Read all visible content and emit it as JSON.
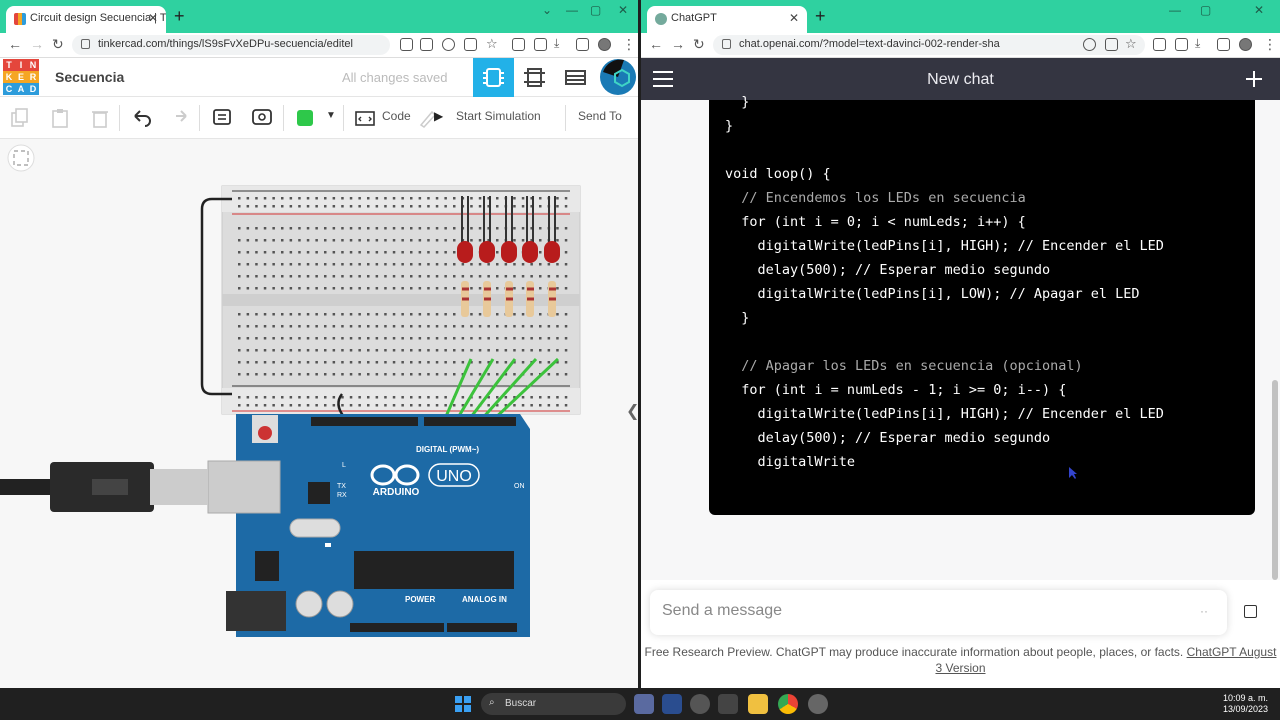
{
  "left_browser": {
    "tab_title": "Circuit design Secuencia | Tinke",
    "url": "tinkercad.com/things/lS9sFvXeDPu-secuencia/editel"
  },
  "right_browser": {
    "tab_title": "ChatGPT",
    "url": "chat.openai.com/?model=text-davinci-002-render-sha"
  },
  "tinkercad": {
    "logo_letters": [
      "T",
      "I",
      "N",
      "K",
      "E",
      "R",
      "C",
      "A",
      "D"
    ],
    "logo_colors": [
      "#e4463c",
      "#e4463c",
      "#e4463c",
      "#f5a623",
      "#f5a623",
      "#f5a623",
      "#2d9cdb",
      "#2d9cdb",
      "#2d9cdb"
    ],
    "design_name": "Secuencia",
    "save_status": "All changes saved",
    "code_label": "Code",
    "start_simulation_label": "Start Simulation",
    "send_to_label": "Send To",
    "accent": "#22b1e8",
    "color_swatch": "#2ec84a"
  },
  "arduino": {
    "brand": "ARDUINO",
    "model": "UNO",
    "digital_label": "DIGITAL (PWM~)",
    "power_label": "POWER",
    "analog_label": "ANALOG IN",
    "on_label": "ON",
    "tx_label": "TX",
    "rx_label": "RX",
    "l_label": "L"
  },
  "chatgpt": {
    "title": "New chat",
    "code_lines": [
      "  }",
      "}",
      "",
      "void loop() {",
      "  // Encendemos los LEDs en secuencia",
      "  for (int i = 0; i < numLeds; i++) {",
      "    digitalWrite(ledPins[i], HIGH); // Encender el LED",
      "    delay(500); // Esperar medio segundo",
      "    digitalWrite(ledPins[i], LOW); // Apagar el LED",
      "  }",
      "",
      "  // Apagar los LEDs en secuencia (opcional)",
      "  for (int i = numLeds - 1; i >= 0; i--) {",
      "    digitalWrite(ledPins[i], HIGH); // Encender el LED",
      "    delay(500); // Esperar medio segundo",
      "    digitalWrite"
    ],
    "input_placeholder": "Send a message",
    "footer_text": "Free Research Preview. ChatGPT may produce inaccurate information about people, places, or facts.",
    "footer_link": "ChatGPT August 3 Version"
  },
  "taskbar": {
    "search_label": "Buscar",
    "time": "10:09 a. m.",
    "date": "13/09/2023"
  }
}
